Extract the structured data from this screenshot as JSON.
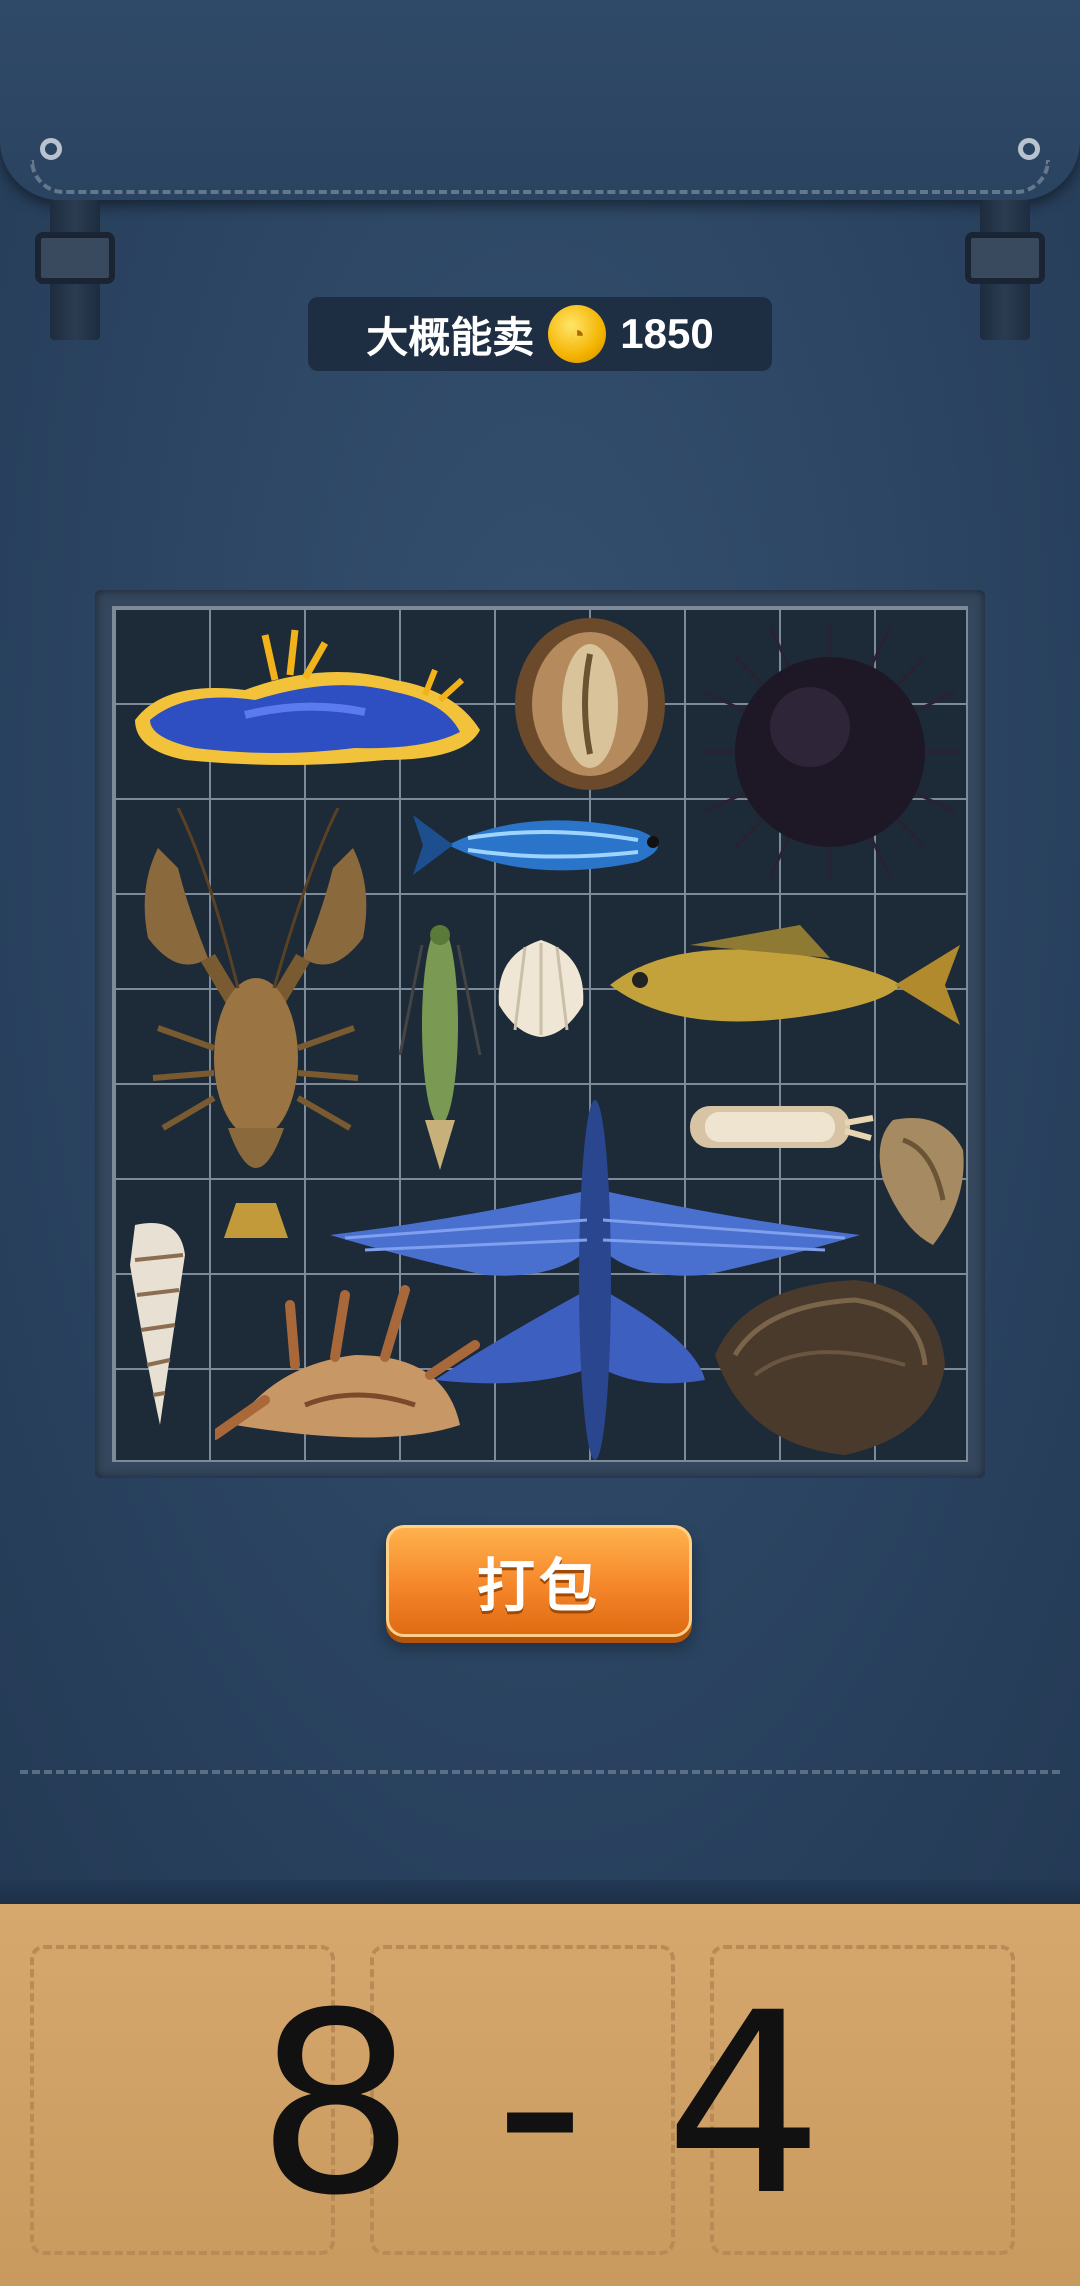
{
  "estimate": {
    "label": "大概能卖",
    "coin_icon": "coin-icon",
    "value": "1850"
  },
  "button": {
    "label": "打包"
  },
  "level": {
    "text": "8 - 4"
  },
  "items": [
    "sea-slug",
    "abalone",
    "sea-urchin",
    "striped-fish",
    "crayfish",
    "shrimp",
    "clam-shell",
    "yellow-croaker",
    "razor-clam",
    "oyster",
    "flying-fish",
    "auger-shell",
    "spider-conch",
    "mussel"
  ],
  "colors": {
    "bag": "#2b4461",
    "grid_bg": "#1d2a38",
    "button": "#f5862a",
    "cardboard": "#d6a86e"
  }
}
